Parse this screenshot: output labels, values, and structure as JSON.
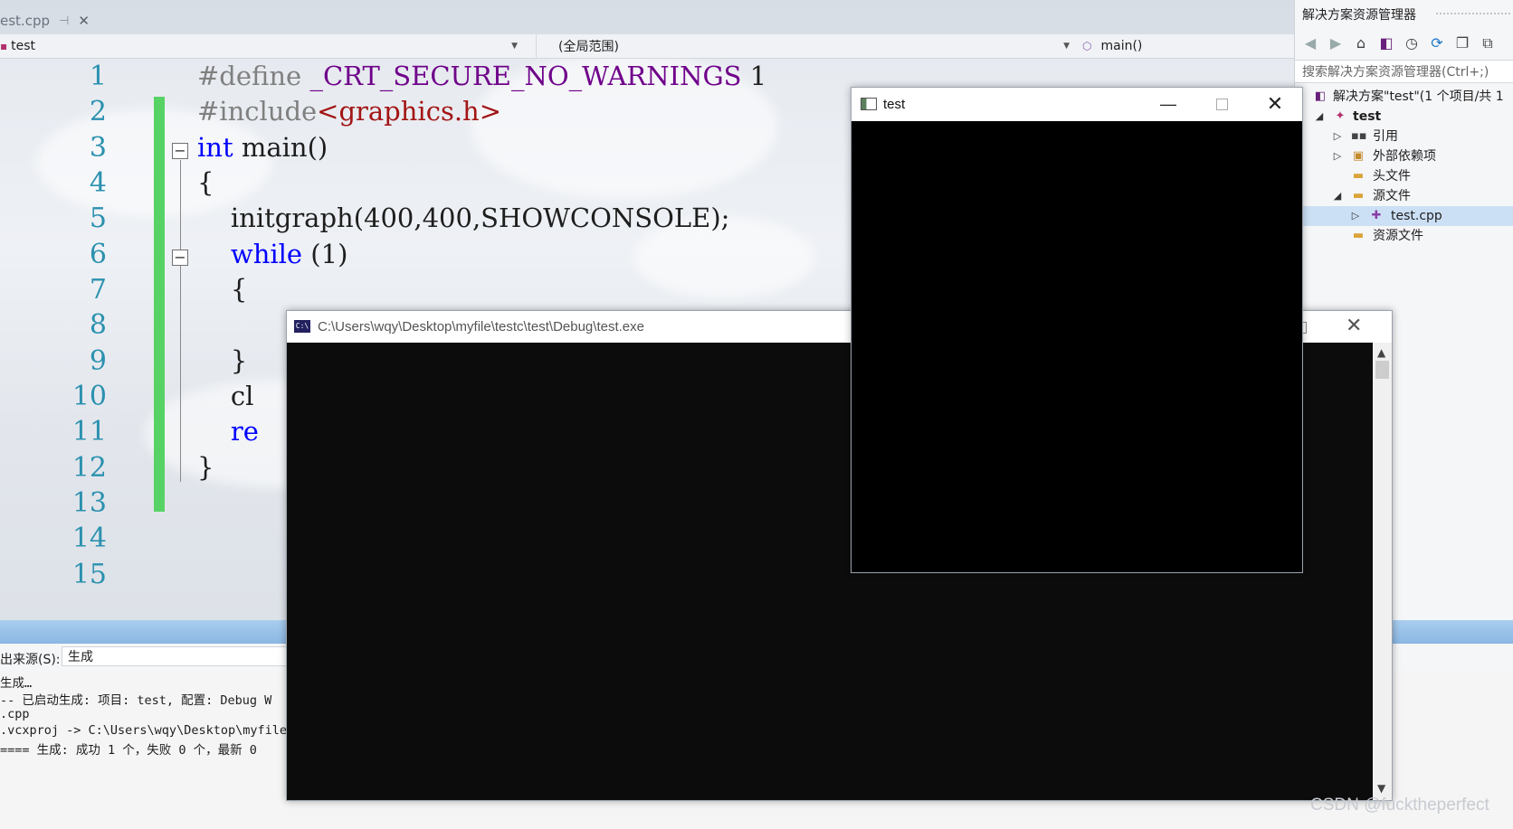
{
  "editor": {
    "tab_label": "est.cpp",
    "pin_glyph": "⊣",
    "close_glyph": "✕",
    "nav": {
      "project": "test",
      "scope": "(全局范围)",
      "member": "main()"
    },
    "line_numbers": [
      "1",
      "2",
      "3",
      "4",
      "5",
      "6",
      "7",
      "8",
      "9",
      "10",
      "11",
      "12",
      "13",
      "14",
      "15"
    ],
    "code": {
      "l1_a": "#define ",
      "l1_b": "_CRT_SECURE_NO_WARNINGS",
      "l1_c": " 1",
      "l2_a": "#include",
      "l2_b": "<graphics.h>",
      "l3_kw": "int",
      "l3_rest": " main()",
      "l4": "{",
      "l5": "    initgraph(400,400,SHOWCONSOLE);",
      "l6_kw": "    while",
      "l6_rest": " (1)",
      "l7": "    {",
      "l9": "    }",
      "l10": "    cl",
      "l11_kw": "    re",
      "l12": "}"
    },
    "fold_glyph": "−"
  },
  "output": {
    "source_label": "出来源(S):",
    "source_value": "生成",
    "lines": [
      "生成…",
      "-- 已启动生成: 项目: test, 配置: Debug W",
      ".cpp",
      ".vcxproj -> C:\\Users\\wqy\\Desktop\\myfile\\",
      "==== 生成: 成功 1 个，失败 0 个，最新 0"
    ]
  },
  "solution_explorer": {
    "title": "解决方案资源管理器",
    "search_placeholder": "搜索解决方案资源管理器(Ctrl+;)",
    "toolbar_icons": [
      "back-icon",
      "forward-icon",
      "home-icon",
      "vs-switch-icon",
      "history-icon",
      "refresh-icon",
      "collapse-icon",
      "copy-icon"
    ],
    "tree": [
      {
        "label": "解决方案\"test\"(1 个项目/共 1",
        "icon": "solution-icon",
        "arrow": "",
        "bold": false
      },
      {
        "label": "test",
        "icon": "project-icon",
        "arrow": "◢",
        "bold": true
      },
      {
        "label": "引用",
        "icon": "references-icon",
        "arrow": "▷",
        "bold": false
      },
      {
        "label": "外部依赖项",
        "icon": "external-deps-icon",
        "arrow": "▷",
        "bold": false
      },
      {
        "label": "头文件",
        "icon": "folder-icon",
        "arrow": "",
        "bold": false
      },
      {
        "label": "源文件",
        "icon": "folder-icon",
        "arrow": "◢",
        "bold": false
      },
      {
        "label": "test.cpp",
        "icon": "cpp-file-icon",
        "arrow": "▷",
        "bold": false
      },
      {
        "label": "资源文件",
        "icon": "folder-icon",
        "arrow": "",
        "bold": false
      }
    ]
  },
  "console_window": {
    "icon_text": "C:\\",
    "title": "C:\\Users\\wqy\\Desktop\\myfile\\testc\\test\\Debug\\test.exe",
    "close_glyph": "✕"
  },
  "graphics_window": {
    "title": "test",
    "min_glyph": "—",
    "close_glyph": "✕"
  },
  "watermark": "CSDN @fucktheperfect",
  "colors": {
    "keyword": "#0000ff",
    "line_number": "#2b91af",
    "change_bar": "#57d365",
    "string": "#a31515",
    "console_bg": "#0c0c0c"
  }
}
